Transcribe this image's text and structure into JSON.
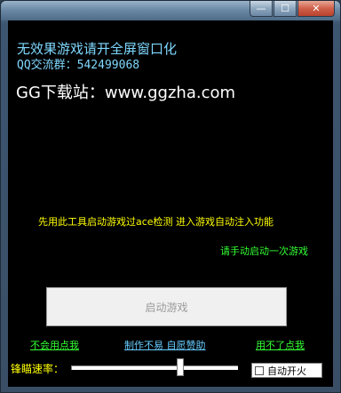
{
  "window": {
    "controls": {
      "minimize": "—",
      "maximize": "☐",
      "close": "✕"
    }
  },
  "content": {
    "line1": "无效果游戏请开全屏窗口化",
    "line2": "QQ交流群：542499068",
    "site": "GG下载站：www.ggzha.com",
    "notice": "先用此工具启动游戏过ace检测 进入游戏自动注入功能",
    "manual_hint": "请手动启动一次游戏"
  },
  "start_button": {
    "label": "启动游戏"
  },
  "links": {
    "dont_know": "不会用点我",
    "donate": "制作不易 自愿赞助",
    "cant_use": "用不了点我"
  },
  "aim_speed": {
    "label": "锋瞄速率：",
    "value": 0.66
  },
  "auto_fire": {
    "label": "自动开火",
    "checked": false
  }
}
